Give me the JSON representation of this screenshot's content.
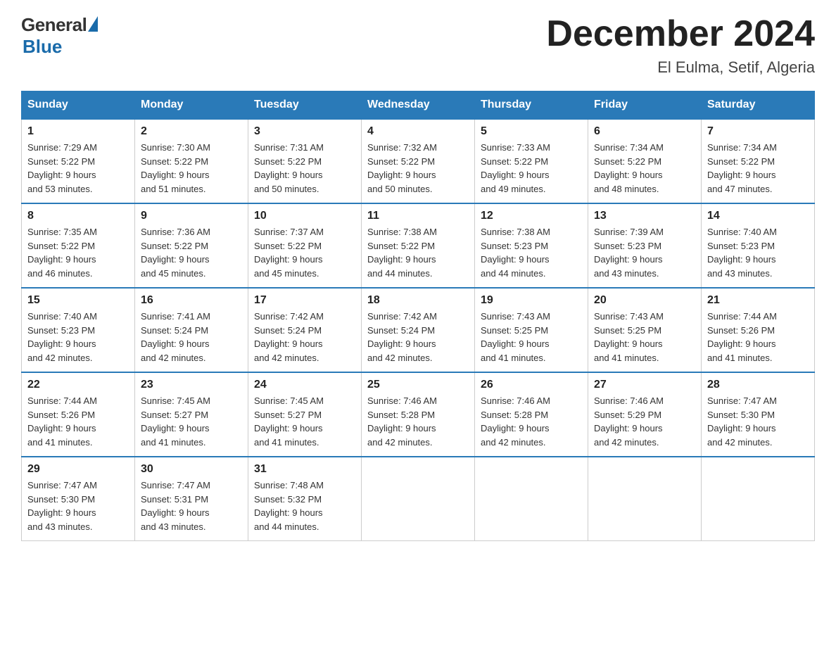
{
  "header": {
    "logo_general": "General",
    "logo_blue": "Blue",
    "title": "December 2024",
    "subtitle": "El Eulma, Setif, Algeria"
  },
  "days_of_week": [
    "Sunday",
    "Monday",
    "Tuesday",
    "Wednesday",
    "Thursday",
    "Friday",
    "Saturday"
  ],
  "weeks": [
    [
      {
        "day": "1",
        "sunrise": "7:29 AM",
        "sunset": "5:22 PM",
        "daylight": "9 hours and 53 minutes."
      },
      {
        "day": "2",
        "sunrise": "7:30 AM",
        "sunset": "5:22 PM",
        "daylight": "9 hours and 51 minutes."
      },
      {
        "day": "3",
        "sunrise": "7:31 AM",
        "sunset": "5:22 PM",
        "daylight": "9 hours and 50 minutes."
      },
      {
        "day": "4",
        "sunrise": "7:32 AM",
        "sunset": "5:22 PM",
        "daylight": "9 hours and 50 minutes."
      },
      {
        "day": "5",
        "sunrise": "7:33 AM",
        "sunset": "5:22 PM",
        "daylight": "9 hours and 49 minutes."
      },
      {
        "day": "6",
        "sunrise": "7:34 AM",
        "sunset": "5:22 PM",
        "daylight": "9 hours and 48 minutes."
      },
      {
        "day": "7",
        "sunrise": "7:34 AM",
        "sunset": "5:22 PM",
        "daylight": "9 hours and 47 minutes."
      }
    ],
    [
      {
        "day": "8",
        "sunrise": "7:35 AM",
        "sunset": "5:22 PM",
        "daylight": "9 hours and 46 minutes."
      },
      {
        "day": "9",
        "sunrise": "7:36 AM",
        "sunset": "5:22 PM",
        "daylight": "9 hours and 45 minutes."
      },
      {
        "day": "10",
        "sunrise": "7:37 AM",
        "sunset": "5:22 PM",
        "daylight": "9 hours and 45 minutes."
      },
      {
        "day": "11",
        "sunrise": "7:38 AM",
        "sunset": "5:22 PM",
        "daylight": "9 hours and 44 minutes."
      },
      {
        "day": "12",
        "sunrise": "7:38 AM",
        "sunset": "5:23 PM",
        "daylight": "9 hours and 44 minutes."
      },
      {
        "day": "13",
        "sunrise": "7:39 AM",
        "sunset": "5:23 PM",
        "daylight": "9 hours and 43 minutes."
      },
      {
        "day": "14",
        "sunrise": "7:40 AM",
        "sunset": "5:23 PM",
        "daylight": "9 hours and 43 minutes."
      }
    ],
    [
      {
        "day": "15",
        "sunrise": "7:40 AM",
        "sunset": "5:23 PM",
        "daylight": "9 hours and 42 minutes."
      },
      {
        "day": "16",
        "sunrise": "7:41 AM",
        "sunset": "5:24 PM",
        "daylight": "9 hours and 42 minutes."
      },
      {
        "day": "17",
        "sunrise": "7:42 AM",
        "sunset": "5:24 PM",
        "daylight": "9 hours and 42 minutes."
      },
      {
        "day": "18",
        "sunrise": "7:42 AM",
        "sunset": "5:24 PM",
        "daylight": "9 hours and 42 minutes."
      },
      {
        "day": "19",
        "sunrise": "7:43 AM",
        "sunset": "5:25 PM",
        "daylight": "9 hours and 41 minutes."
      },
      {
        "day": "20",
        "sunrise": "7:43 AM",
        "sunset": "5:25 PM",
        "daylight": "9 hours and 41 minutes."
      },
      {
        "day": "21",
        "sunrise": "7:44 AM",
        "sunset": "5:26 PM",
        "daylight": "9 hours and 41 minutes."
      }
    ],
    [
      {
        "day": "22",
        "sunrise": "7:44 AM",
        "sunset": "5:26 PM",
        "daylight": "9 hours and 41 minutes."
      },
      {
        "day": "23",
        "sunrise": "7:45 AM",
        "sunset": "5:27 PM",
        "daylight": "9 hours and 41 minutes."
      },
      {
        "day": "24",
        "sunrise": "7:45 AM",
        "sunset": "5:27 PM",
        "daylight": "9 hours and 41 minutes."
      },
      {
        "day": "25",
        "sunrise": "7:46 AM",
        "sunset": "5:28 PM",
        "daylight": "9 hours and 42 minutes."
      },
      {
        "day": "26",
        "sunrise": "7:46 AM",
        "sunset": "5:28 PM",
        "daylight": "9 hours and 42 minutes."
      },
      {
        "day": "27",
        "sunrise": "7:46 AM",
        "sunset": "5:29 PM",
        "daylight": "9 hours and 42 minutes."
      },
      {
        "day": "28",
        "sunrise": "7:47 AM",
        "sunset": "5:30 PM",
        "daylight": "9 hours and 42 minutes."
      }
    ],
    [
      {
        "day": "29",
        "sunrise": "7:47 AM",
        "sunset": "5:30 PM",
        "daylight": "9 hours and 43 minutes."
      },
      {
        "day": "30",
        "sunrise": "7:47 AM",
        "sunset": "5:31 PM",
        "daylight": "9 hours and 43 minutes."
      },
      {
        "day": "31",
        "sunrise": "7:48 AM",
        "sunset": "5:32 PM",
        "daylight": "9 hours and 44 minutes."
      },
      null,
      null,
      null,
      null
    ]
  ],
  "labels": {
    "sunrise": "Sunrise:",
    "sunset": "Sunset:",
    "daylight": "Daylight:"
  }
}
